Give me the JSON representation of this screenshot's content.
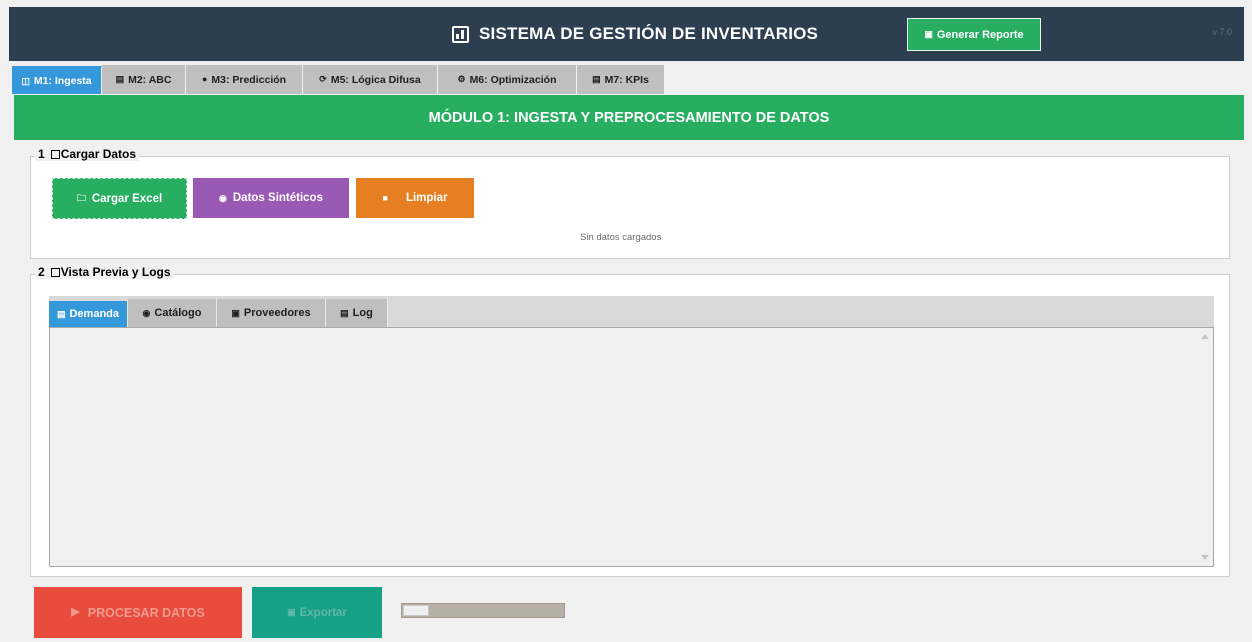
{
  "header": {
    "title": "SISTEMA DE GESTIÓN DE INVENTARIOS",
    "report_button": "Generar Reporte",
    "version": "v 7.0",
    "logo_icon": "bar-chart-icon"
  },
  "tabs": [
    {
      "label": "M1: Ingesta",
      "icon": "inbox-icon",
      "active": true
    },
    {
      "label": "M2: ABC",
      "icon": "chart-icon",
      "active": false
    },
    {
      "label": "M3: Predicción",
      "icon": "dot-icon",
      "active": false
    },
    {
      "label": "M5: Lógica Difusa",
      "icon": "cycle-icon",
      "active": false
    },
    {
      "label": "M6: Optimización",
      "icon": "gear-icon",
      "active": false
    },
    {
      "label": "M7: KPIs",
      "icon": "trend-icon",
      "active": false
    }
  ],
  "banner": {
    "title": "MÓDULO 1: INGESTA Y PREPROCESAMIENTO DE DATOS"
  },
  "section1": {
    "number": "1",
    "title": "Cargar Datos",
    "buttons": {
      "excel": "Cargar Excel",
      "synthetic": "Datos Sintéticos",
      "clear": "Limpiar"
    },
    "status": "Sin datos cargados"
  },
  "section2": {
    "number": "2",
    "title": "Vista Previa y Logs",
    "tabs": [
      {
        "label": "Demanda",
        "icon": "chart-icon",
        "active": true
      },
      {
        "label": "Catálogo",
        "icon": "box-icon",
        "active": false
      },
      {
        "label": "Proveedores",
        "icon": "truck-icon",
        "active": false
      },
      {
        "label": "Log",
        "icon": "doc-icon",
        "active": false
      }
    ]
  },
  "footer": {
    "process_button": "PROCESAR DATOS",
    "export_button": "Exportar",
    "progress_percent": 16
  },
  "colors": {
    "header_bg": "#2c3e50",
    "green": "#27ae60",
    "purple": "#9b59b6",
    "orange": "#e67e22",
    "blue": "#3498db",
    "red": "#e74c3c",
    "teal": "#16a085"
  }
}
